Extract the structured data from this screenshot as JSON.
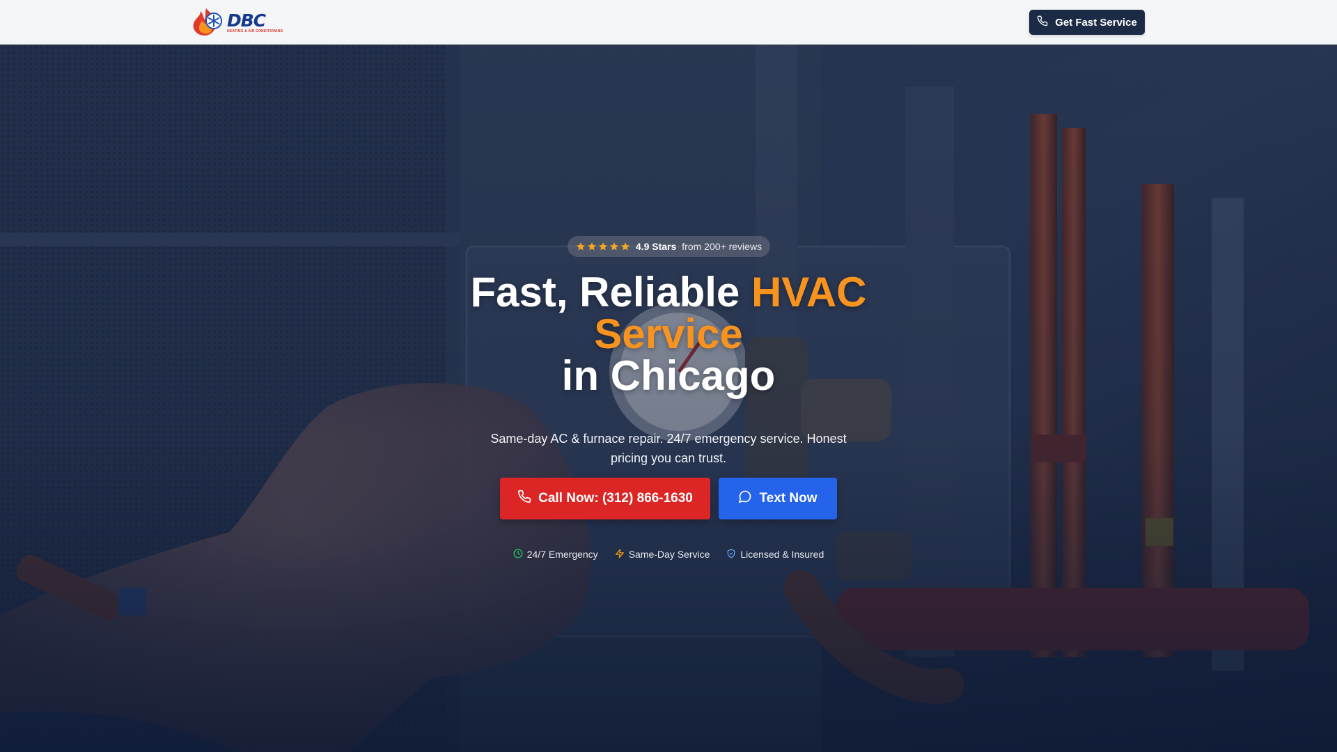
{
  "header": {
    "logo_text": "DBC",
    "logo_tagline": "HEATING & AIR CONDITIONING",
    "cta_label": "Get Fast Service"
  },
  "hero": {
    "rating": {
      "stars": 5,
      "value_label": "4.9 Stars",
      "sub_label": "from 200+ reviews"
    },
    "headline": {
      "part1": "Fast, Reliable ",
      "accent1": "HVAC",
      "accent2": "Service",
      "part2": "in Chicago"
    },
    "subheadline": "Same-day AC & furnace repair. 24/7 emergency service. Honest pricing you can trust.",
    "call_button_label": "Call Now: (312) 866-1630",
    "text_button_label": "Text Now",
    "trust_badges": [
      {
        "label": "24/7 Emergency",
        "icon": "clock-icon"
      },
      {
        "label": "Same-Day Service",
        "icon": "lightning-icon"
      },
      {
        "label": "Licensed & Insured",
        "icon": "shield-icon"
      }
    ]
  },
  "colors": {
    "accent_orange": "#f7931e",
    "call_red": "#dc2626",
    "text_blue": "#2563eb",
    "header_cta_navy": "#1b2a45",
    "star_yellow": "#f5a623",
    "trust_clock_green": "#22c55e",
    "trust_bolt_yellow": "#f59e0b",
    "trust_shield_blue": "#60a5fa"
  }
}
